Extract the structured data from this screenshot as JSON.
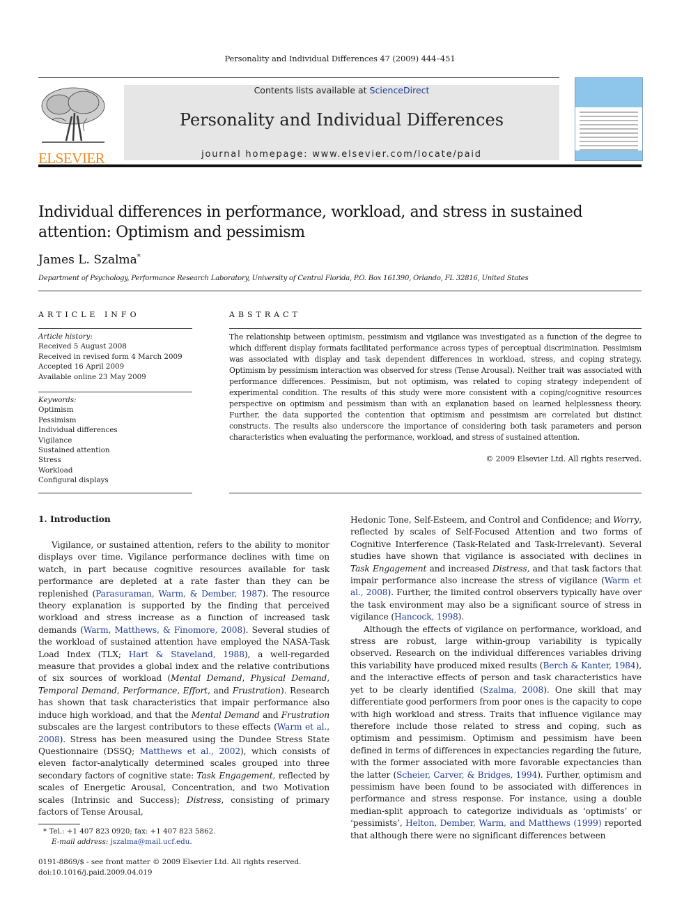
{
  "running_head": "Personality and Individual Differences 47 (2009) 444–451",
  "publisher": {
    "logo_word": "ELSEVIER",
    "brand_color": "#f28a1c"
  },
  "banner": {
    "contents_prefix": "Contents lists available at ",
    "contents_link": "ScienceDirect",
    "journal_title": "Personality and Individual Differences",
    "homepage": "journal homepage: www.elsevier.com/locate/paid",
    "link_color": "#1f3a93"
  },
  "article": {
    "title": "Individual differences in performance, workload, and stress in sustained attention: Optimism and pessimism",
    "author": "James L. Szalma",
    "author_mark": "*",
    "affiliation": "Department of Psychology, Performance Research Laboratory, University of Central Florida, P.O. Box 161390, Orlando, FL 32816, United States"
  },
  "article_info": {
    "heading": "ARTICLE INFO",
    "history_label": "Article history:",
    "history": [
      "Received 5 August 2008",
      "Received in revised form 4 March 2009",
      "Accepted 16 April 2009",
      "Available online 23 May 2009"
    ],
    "keywords_label": "Keywords:",
    "keywords": [
      "Optimism",
      "Pessimism",
      "Individual differences",
      "Vigilance",
      "Sustained attention",
      "Stress",
      "Workload",
      "Configural displays"
    ]
  },
  "abstract": {
    "heading": "ABSTRACT",
    "text": "The relationship between optimism, pessimism and vigilance was investigated as a function of the degree to which different display formats facilitated performance across types of perceptual discrimination. Pessimism was associated with display and task dependent differences in workload, stress, and coping strategy. Optimism by pessimism interaction was observed for stress (Tense Arousal). Neither trait was associated with performance differences. Pessimism, but not optimism, was related to coping strategy independent of experimental condition. The results of this study were more consistent with a coping/cognitive resources perspective on optimism and pessimism than with an explanation based on learned helplessness theory. Further, the data supported the contention that optimism and pessimism are correlated but distinct constructs. The results also underscore the importance of considering both task parameters and person characteristics when evaluating the performance, workload, and stress of sustained attention.",
    "copyright": "© 2009 Elsevier Ltd. All rights reserved."
  },
  "body": {
    "section_heading": "1. Introduction",
    "left": {
      "p1": [
        {
          "t": "Vigilance, or sustained attention, refers to the ability to monitor displays over time. Vigilance performance declines with time on watch, in part because cognitive resources available for task performance are depleted at a rate faster than they can be replenished ("
        },
        {
          "c": "Parasuraman, Warm, & Dember, 1987"
        },
        {
          "t": "). The resource theory explanation is supported by the finding that perceived workload and stress increase as a function of increased task demands ("
        },
        {
          "c": "Warm, Matthews, & Finomore, 2008"
        },
        {
          "t": "). Several studies of the workload of sustained attention have employed the NASA-Task Load Index (TLX; "
        },
        {
          "c": "Hart & Staveland, 1988"
        },
        {
          "t": "), a well-regarded measure that provides a global index and the relative contributions of six sources of workload ("
        },
        {
          "i": "Mental Demand"
        },
        {
          "t": ", "
        },
        {
          "i": "Physical Demand"
        },
        {
          "t": ", "
        },
        {
          "i": "Temporal Demand"
        },
        {
          "t": ", "
        },
        {
          "i": "Performance"
        },
        {
          "t": ", "
        },
        {
          "i": "Effort"
        },
        {
          "t": ", and "
        },
        {
          "i": "Frustration"
        },
        {
          "t": "). Research has shown that task characteristics that impair performance also induce high workload, and that the "
        },
        {
          "i": "Mental Demand"
        },
        {
          "t": " and "
        },
        {
          "i": "Frustration"
        },
        {
          "t": " subscales are the largest contributors to these effects ("
        },
        {
          "c": "Warm et al., 2008"
        },
        {
          "t": "). Stress has been measured using the Dundee Stress State Questionnaire (DSSQ; "
        },
        {
          "c": "Matthews et al., 2002"
        },
        {
          "t": "), which consists of eleven factor-analytically determined scales grouped into three secondary factors of cognitive state: "
        },
        {
          "i": "Task Engagement"
        },
        {
          "t": ", reflected by scales of Energetic Arousal, Concentration, and two Motivation scales (Intrinsic and Success); "
        },
        {
          "i": "Distress"
        },
        {
          "t": ", consisting of primary factors of Tense Arousal,"
        }
      ]
    },
    "right": {
      "p1": [
        {
          "t": "Hedonic Tone, Self-Esteem, and Control and Confidence; and "
        },
        {
          "i": "Worry"
        },
        {
          "t": ", reflected by scales of Self-Focused Attention and two forms of Cognitive Interference (Task-Related and Task-Irrelevant). Several studies have shown that vigilance is associated with declines in "
        },
        {
          "i": "Task Engagement"
        },
        {
          "t": " and increased "
        },
        {
          "i": "Distress"
        },
        {
          "t": ", and that task factors that impair performance also increase the stress of vigilance ("
        },
        {
          "c": "Warm et al., 2008"
        },
        {
          "t": "). Further, the limited control observers typically have over the task environment may also be a significant source of stress in vigilance ("
        },
        {
          "c": "Hancock, 1998"
        },
        {
          "t": ")."
        }
      ],
      "p2": [
        {
          "t": "Although the effects of vigilance on performance, workload, and stress are robust, large within-group variability is typically observed. Research on the individual differences variables driving this variability have produced mixed results ("
        },
        {
          "c": "Berch & Kanter, 1984"
        },
        {
          "t": "), and the interactive effects of person and task characteristics have yet to be clearly identified ("
        },
        {
          "c": "Szalma, 2008"
        },
        {
          "t": "). One skill that may differentiate good performers from poor ones is the capacity to cope with high workload and stress. Traits that influence vigilance may therefore include those related to stress and coping, such as optimism and pessimism. Optimism and pessimism have been defined in terms of differences in expectancies regarding the future, with the former associated with more favorable expectancies than the latter ("
        },
        {
          "c": "Scheier, Carver, & Bridges, 1994"
        },
        {
          "t": "). Further, optimism and pessimism have been found to be associated with differences in performance and stress response. For instance, using a double median-split approach to categorize individuals as ‘optimists’ or ‘pessimists’, "
        },
        {
          "c": "Helton, Dember, Warm, and Matthews (1999)"
        },
        {
          "t": " reported that although there were no significant differences between"
        }
      ]
    }
  },
  "footnote": {
    "mark": "*",
    "contact": "Tel.: +1 407 823 0920; fax: +1 407 823 5862.",
    "email_label": "E-mail address:",
    "email": "jszalma@mail.ucf.edu",
    "email_suffix": "."
  },
  "front_matter": {
    "issn_line": "0191-8869/$ - see front matter © 2009 Elsevier Ltd. All rights reserved.",
    "doi": "doi:10.1016/j.paid.2009.04.019"
  }
}
